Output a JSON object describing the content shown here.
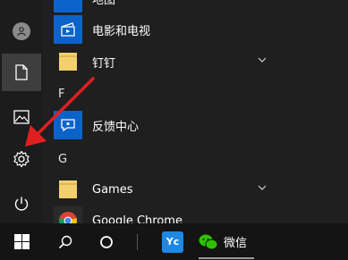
{
  "app_list": {
    "items": [
      {
        "label": "电影和电视",
        "icon": "film-icon"
      },
      {
        "label": "钉钉",
        "icon": "folder-icon"
      },
      {
        "label": "反馈中心",
        "icon": "feedback-icon"
      },
      {
        "label": "Games",
        "icon": "folder-icon"
      },
      {
        "label": "Google Chrome",
        "icon": "chrome-icon"
      }
    ],
    "section_f": "F",
    "section_g": "G",
    "partial_top_label": "地图"
  },
  "rail": {
    "items": [
      "user-icon",
      "document-icon",
      "pictures-icon",
      "settings-icon",
      "power-icon"
    ]
  },
  "taskbar": {
    "wechat_label": "微信",
    "yc_label": "Yc"
  },
  "colors": {
    "accent_tile": "#0b63c9",
    "arrow": "#e02020",
    "folder": "#f3cf6e"
  }
}
